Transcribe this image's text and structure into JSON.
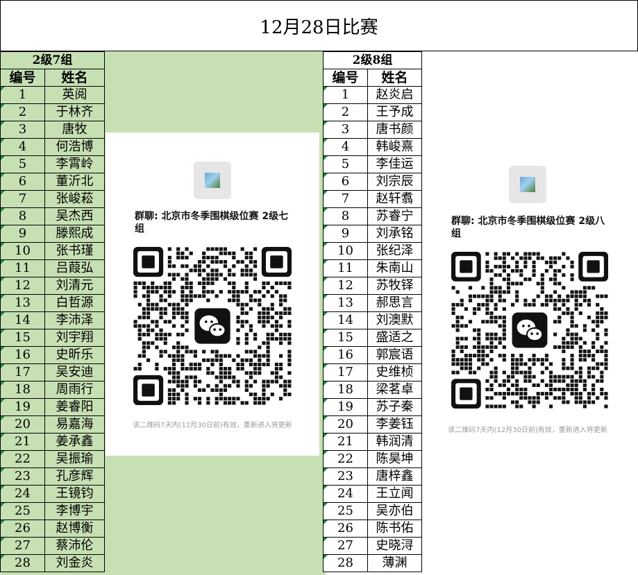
{
  "title": "12月28日比赛",
  "groups": [
    {
      "name": "2级7组",
      "col_num": "编号",
      "col_name": "姓名",
      "players": [
        {
          "num": "1",
          "name": "英阅"
        },
        {
          "num": "2",
          "name": "于林齐"
        },
        {
          "num": "3",
          "name": "唐牧"
        },
        {
          "num": "4",
          "name": "何浩博"
        },
        {
          "num": "5",
          "name": "李霄岭"
        },
        {
          "num": "6",
          "name": "董沂北"
        },
        {
          "num": "7",
          "name": "张峻菘"
        },
        {
          "num": "8",
          "name": "吴杰西"
        },
        {
          "num": "9",
          "name": "滕熙成"
        },
        {
          "num": "10",
          "name": "张书瑾"
        },
        {
          "num": "11",
          "name": "吕葭弘"
        },
        {
          "num": "12",
          "name": "刘清元"
        },
        {
          "num": "13",
          "name": "白哲源"
        },
        {
          "num": "14",
          "name": "李沛泽"
        },
        {
          "num": "15",
          "name": "刘宇翔"
        },
        {
          "num": "16",
          "name": "史昕乐"
        },
        {
          "num": "17",
          "name": "吴安迪"
        },
        {
          "num": "18",
          "name": "周雨行"
        },
        {
          "num": "19",
          "name": "姜睿阳"
        },
        {
          "num": "20",
          "name": "易嘉海"
        },
        {
          "num": "21",
          "name": "姜承鑫"
        },
        {
          "num": "22",
          "name": "吴振瑜"
        },
        {
          "num": "23",
          "name": "孔彦辉"
        },
        {
          "num": "24",
          "name": "王镜钧"
        },
        {
          "num": "25",
          "name": "李博宇"
        },
        {
          "num": "26",
          "name": "赵博衡"
        },
        {
          "num": "27",
          "name": "蔡沛伦"
        },
        {
          "num": "28",
          "name": "刘金炎"
        }
      ]
    },
    {
      "name": "2级8组",
      "col_num": "编号",
      "col_name": "姓名",
      "players": [
        {
          "num": "1",
          "name": "赵炎启"
        },
        {
          "num": "2",
          "name": "王予成"
        },
        {
          "num": "3",
          "name": "唐书颜"
        },
        {
          "num": "4",
          "name": "韩峻熹"
        },
        {
          "num": "5",
          "name": "李佳运"
        },
        {
          "num": "6",
          "name": "刘宗辰"
        },
        {
          "num": "7",
          "name": "赵轩翥"
        },
        {
          "num": "8",
          "name": "苏睿宁"
        },
        {
          "num": "9",
          "name": "刘承铭"
        },
        {
          "num": "10",
          "name": "张纪泽"
        },
        {
          "num": "11",
          "name": "朱南山"
        },
        {
          "num": "12",
          "name": "苏牧铎"
        },
        {
          "num": "13",
          "name": "郝思言"
        },
        {
          "num": "14",
          "name": "刘澳默"
        },
        {
          "num": "15",
          "name": "盛适之"
        },
        {
          "num": "16",
          "name": "郭宸语"
        },
        {
          "num": "17",
          "name": "史维桢"
        },
        {
          "num": "18",
          "name": "梁茗卓"
        },
        {
          "num": "19",
          "name": "苏子秦"
        },
        {
          "num": "20",
          "name": "李姜钰"
        },
        {
          "num": "21",
          "name": "韩润清"
        },
        {
          "num": "22",
          "name": "陈昊坤"
        },
        {
          "num": "23",
          "name": "唐梓鑫"
        },
        {
          "num": "24",
          "name": "王立闻"
        },
        {
          "num": "25",
          "name": "吴亦伯"
        },
        {
          "num": "26",
          "name": "陈书佑"
        },
        {
          "num": "27",
          "name": "史晓浔"
        },
        {
          "num": "28",
          "name": "薄渊"
        }
      ]
    }
  ],
  "qr_cards": [
    {
      "group_title": "群聊: 北京市冬季围棋级位赛 2级七组",
      "footer": "该二维码7天内(12月30日前)有效，重新进入将更新",
      "avatar_icon": "group-avatar-icon",
      "center_icon": "wechat-logo-icon"
    },
    {
      "group_title": "群聊: 北京市冬季围棋级位赛 2级八组",
      "footer": "该二维码7天内(12月30日前)有效，重新进入将更新",
      "avatar_icon": "group-avatar-icon",
      "center_icon": "wechat-logo-icon"
    }
  ],
  "colors": {
    "left_background": "#c6e0b4",
    "cell_marker": "#1f8a3a"
  }
}
